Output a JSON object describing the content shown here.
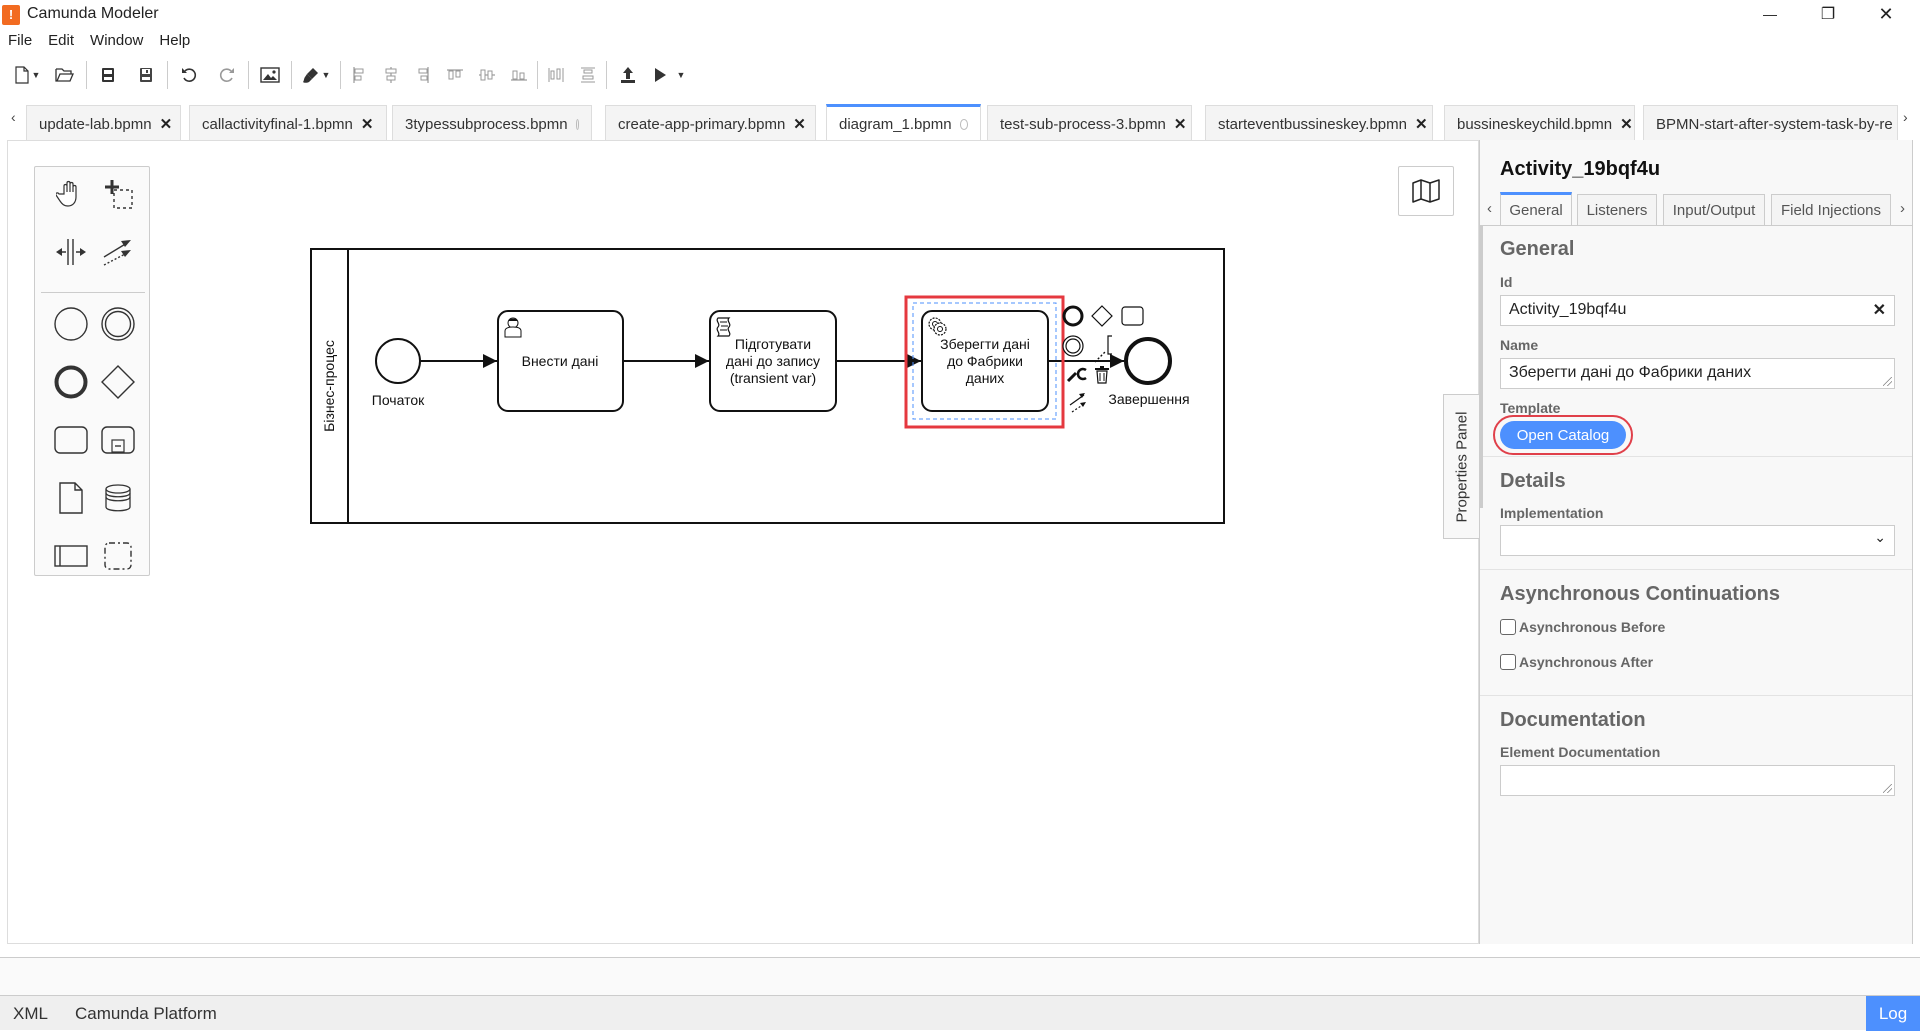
{
  "window": {
    "title": "Camunda Modeler",
    "logo_glyph": "!",
    "controls": {
      "minimize": "—",
      "maximize": "❐",
      "close": "✕"
    }
  },
  "menu": [
    "File",
    "Edit",
    "Window",
    "Help"
  ],
  "toolbar": {
    "buttons": [
      "new-file-icon",
      "open-file-icon",
      "save-icon",
      "save-as-icon",
      "undo-icon",
      "redo-icon",
      "export-image-icon",
      "color-picker-icon",
      "align-left-icon",
      "align-center-icon",
      "align-right-icon",
      "align-top-icon",
      "align-middle-icon",
      "align-bottom-icon",
      "distribute-horizontal-icon",
      "distribute-vertical-icon",
      "deploy-icon",
      "start-instance-icon"
    ]
  },
  "tabs": {
    "scroll_left": "‹",
    "scroll_right": "›",
    "items": [
      {
        "label": "update-lab.bpmn",
        "state": "close",
        "glyph": "✕"
      },
      {
        "label": "callactivityfinal-1.bpmn",
        "state": "close",
        "glyph": "✕"
      },
      {
        "label": "3typessubprocess.bpmn",
        "state": "dirty"
      },
      {
        "label": "create-app-primary.bpmn",
        "state": "close",
        "glyph": "✕"
      },
      {
        "label": "diagram_1.bpmn",
        "state": "dirty",
        "active": true
      },
      {
        "label": "test-sub-process-3.bpmn",
        "state": "close",
        "glyph": "✕"
      },
      {
        "label": "starteventbussineskey.bpmn",
        "state": "close",
        "glyph": "✕"
      },
      {
        "label": "bussineskeychild.bpmn",
        "state": "close",
        "glyph": "✕"
      },
      {
        "label": "BPMN-start-after-system-task-by-re",
        "state": "truncated"
      }
    ]
  },
  "palette": {
    "tools": [
      "hand-tool",
      "lasso-tool",
      "space-tool",
      "global-connect-tool"
    ],
    "shapes": [
      "start-event",
      "intermediate-event",
      "end-event",
      "gateway",
      "task",
      "subprocess",
      "data-object",
      "data-store",
      "pool-participant",
      "group"
    ]
  },
  "diagram": {
    "pool_label": "Бізнес-процес",
    "start_event": {
      "label": "Початок"
    },
    "tasks": [
      {
        "type": "user-task",
        "label_lines": [
          "Внести дані"
        ]
      },
      {
        "type": "script-task",
        "label_lines": [
          "Підготувати",
          "дані до запису",
          "(transient var)"
        ]
      },
      {
        "type": "service-task",
        "label_lines": [
          "Зберегти дані",
          "до Фабрики",
          "даних"
        ],
        "selected": true
      }
    ],
    "end_event": {
      "label": "Завершення"
    },
    "colors": {
      "selection_highlight": "#e5383f",
      "selection_outline": "#4d90fe"
    }
  },
  "properties_toggle": {
    "label": "Properties Panel"
  },
  "properties": {
    "title": "Activity_19bqf4u",
    "tabs": [
      {
        "label": "General",
        "active": true
      },
      {
        "label": "Listeners"
      },
      {
        "label": "Input/Output"
      },
      {
        "label": "Field Injections"
      }
    ],
    "tab_scroll_left": "‹",
    "tab_scroll_right": "›",
    "general": {
      "heading": "General",
      "id_label": "Id",
      "id_value": "Activity_19bqf4u",
      "id_clear": "✕",
      "name_label": "Name",
      "name_value": "Зберегти дані до Фабрики даних",
      "template_label": "Template",
      "open_catalog": "Open Catalog"
    },
    "details": {
      "heading": "Details",
      "implementation_label": "Implementation",
      "implementation_value": ""
    },
    "async": {
      "heading": "Asynchronous Continuations",
      "before_label": "Asynchronous Before",
      "before_checked": false,
      "after_label": "Asynchronous After",
      "after_checked": false
    },
    "documentation": {
      "heading": "Documentation",
      "element_doc_label": "Element Documentation",
      "element_doc_value": ""
    },
    "accent_color": "#4d90fe"
  },
  "statusbar": {
    "xml": "XML",
    "platform": "Camunda Platform",
    "log": "Log"
  }
}
